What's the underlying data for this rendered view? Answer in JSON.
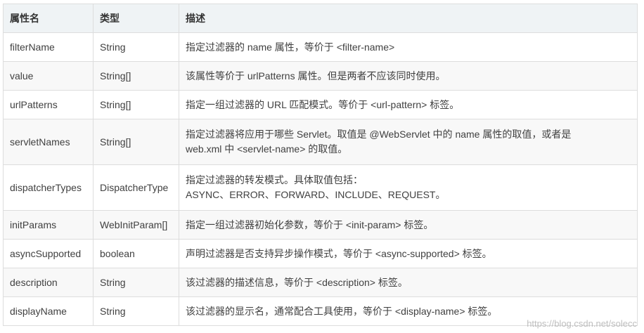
{
  "headers": [
    "属性名",
    "类型",
    "描述"
  ],
  "rows": [
    {
      "name": "filterName",
      "type": "String",
      "desc": [
        "指定过滤器的 name 属性，等价于 <filter-name>"
      ]
    },
    {
      "name": "value",
      "type": "String[]",
      "desc": [
        "该属性等价于 urlPatterns 属性。但是两者不应该同时使用。"
      ]
    },
    {
      "name": "urlPatterns",
      "type": "String[]",
      "desc": [
        "指定一组过滤器的 URL 匹配模式。等价于 <url-pattern> 标签。"
      ]
    },
    {
      "name": "servletNames",
      "type": "String[]",
      "desc": [
        "指定过滤器将应用于哪些 Servlet。取值是 @WebServlet 中的 name 属性的取值，或者是",
        "web.xml 中 <servlet-name> 的取值。"
      ]
    },
    {
      "name": "dispatcherTypes",
      "type": "DispatcherType",
      "desc": [
        "指定过滤器的转发模式。具体取值包括：",
        "ASYNC、ERROR、FORWARD、INCLUDE、REQUEST。"
      ]
    },
    {
      "name": "initParams",
      "type": "WebInitParam[]",
      "desc": [
        "指定一组过滤器初始化参数，等价于 <init-param> 标签。"
      ]
    },
    {
      "name": "asyncSupported",
      "type": "boolean",
      "desc": [
        "声明过滤器是否支持异步操作模式，等价于 <async-supported> 标签。"
      ]
    },
    {
      "name": "description",
      "type": "String",
      "desc": [
        "该过滤器的描述信息，等价于 <description> 标签。"
      ]
    },
    {
      "name": "displayName",
      "type": "String",
      "desc": [
        "该过滤器的显示名，通常配合工具使用，等价于 <display-name> 标签。"
      ]
    }
  ],
  "watermark": "https://blog.csdn.net/solecc"
}
